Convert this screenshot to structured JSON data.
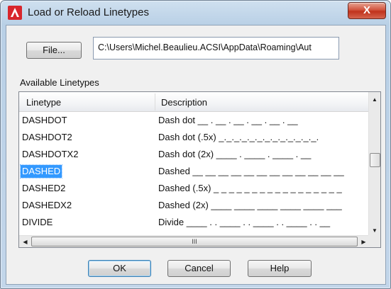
{
  "window": {
    "title": "Load or Reload Linetypes",
    "close_label": "X"
  },
  "file_button": {
    "label": "File..."
  },
  "path_field": {
    "value": "C:\\Users\\Michel.Beaulieu.ACSI\\AppData\\Roaming\\Aut"
  },
  "available_label": "Available Linetypes",
  "list": {
    "columns": [
      "Linetype",
      "Description"
    ],
    "rows": [
      {
        "name": "DASHDOT",
        "description": "Dash dot __ . __ . __ . __ . __ . __",
        "selected": false
      },
      {
        "name": "DASHDOT2",
        "description": "Dash dot (.5x) _._._._._._._._._._._._._.",
        "selected": false
      },
      {
        "name": "DASHDOTX2",
        "description": "Dash dot (2x) ____  .  ____  .  ____  .  __",
        "selected": false
      },
      {
        "name": "DASHED",
        "description": "Dashed __ __ __ __ __ __ __ __ __ __ __ __",
        "selected": true
      },
      {
        "name": "DASHED2",
        "description": "Dashed (.5x) _ _ _ _ _ _ _ _ _ _ _ _ _ _ _ _ _",
        "selected": false
      },
      {
        "name": "DASHEDX2",
        "description": "Dashed (2x) ____  ____  ____  ____  ____  ___",
        "selected": false
      },
      {
        "name": "DIVIDE",
        "description": "Divide ____ . . ____ . . ____ . . ____ . . __",
        "selected": false
      }
    ],
    "hscroll_thumb_glyph": "III"
  },
  "buttons": {
    "ok": "OK",
    "cancel": "Cancel",
    "help": "Help"
  },
  "colors": {
    "selection": "#3399ff",
    "app_icon": "#d8262c",
    "close_button": "#c0321c"
  },
  "icons": {
    "app": "autocad-icon",
    "close": "close-icon",
    "scroll_up": "up-arrow-icon",
    "scroll_down": "down-arrow-icon",
    "scroll_left": "left-arrow-icon",
    "scroll_right": "right-arrow-icon"
  }
}
